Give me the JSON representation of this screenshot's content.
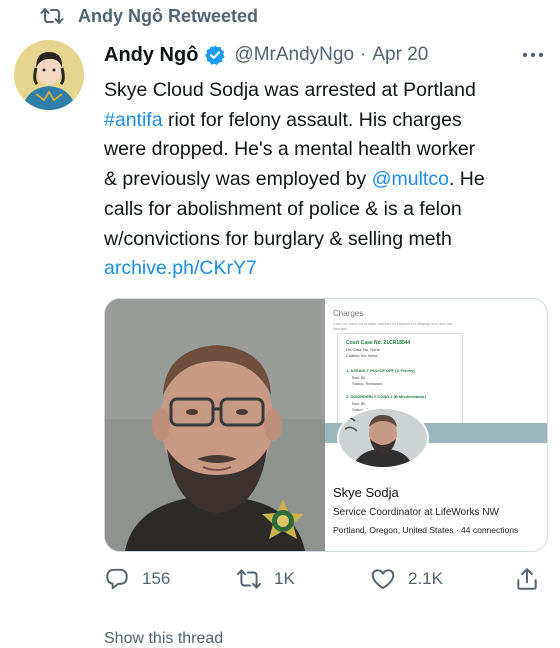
{
  "retweet": {
    "label": "Andy Ngô Retweeted",
    "icon": "retweet-icon"
  },
  "author": {
    "name": "Andy Ngô",
    "handle": "@MrAndyNgo",
    "separator": "·",
    "date": "Apr 20",
    "verified": true,
    "more_icon": "more-icon"
  },
  "tweet": {
    "lines": [
      [
        {
          "text": "Skye Cloud Sodja was arrested at Portland",
          "link": false
        }
      ],
      [
        {
          "text": "#antifa",
          "link": true
        },
        {
          "text": " riot for felony assault. His charges",
          "link": false
        }
      ],
      [
        {
          "text": "were dropped. He's a mental health worker",
          "link": false
        }
      ],
      [
        {
          "text": "& previously was employed by ",
          "link": false
        },
        {
          "text": "@multco",
          "link": true
        },
        {
          "text": ". He",
          "link": false
        }
      ],
      [
        {
          "text": "calls for abolishment of police & is a felon",
          "link": false
        }
      ],
      [
        {
          "text": "w/convictions for burglary & selling meth",
          "link": false
        }
      ],
      [
        {
          "text": "archive.ph/CKrY7",
          "link": true
        }
      ]
    ]
  },
  "media": {
    "charges_title": "Charges",
    "charges_sub": "Click on each court case number to expand the display and see the charges.",
    "case_number": "Court Case No. 21CR18544",
    "da_case": "DA Case No: None",
    "citation": "Citation No: None",
    "charge_1": "1.   ASSAULT POLICE OFF (C Felony)",
    "charge_1_bail": "Bail: $0",
    "charge_1_status": "Status: Released",
    "charge_2": "2.   DISORDERLY COND 2 (B Misdemeanor)",
    "charge_2_bail": "Bail: $0",
    "charge_2_status": "Status: Released",
    "footnote": "Bail required could be full amount or 10% of the full amount.",
    "profile_name": "Skye Sodja",
    "profile_role": "Service Coordinator at LifeWorks NW",
    "profile_location": "Portland, Oregon, United States · 44 connections"
  },
  "actions": {
    "reply_count": "156",
    "retweet_count": "1K",
    "like_count": "2.1K",
    "reply_icon": "reply-icon",
    "retweet_icon": "retweet-icon",
    "like_icon": "heart-icon",
    "share_icon": "share-icon"
  },
  "bottom_partial": "Show this thread",
  "colors": {
    "link": "#1d8ee5",
    "verified": "#1d9bf0",
    "muted": "#536471",
    "text": "#0f1419"
  }
}
